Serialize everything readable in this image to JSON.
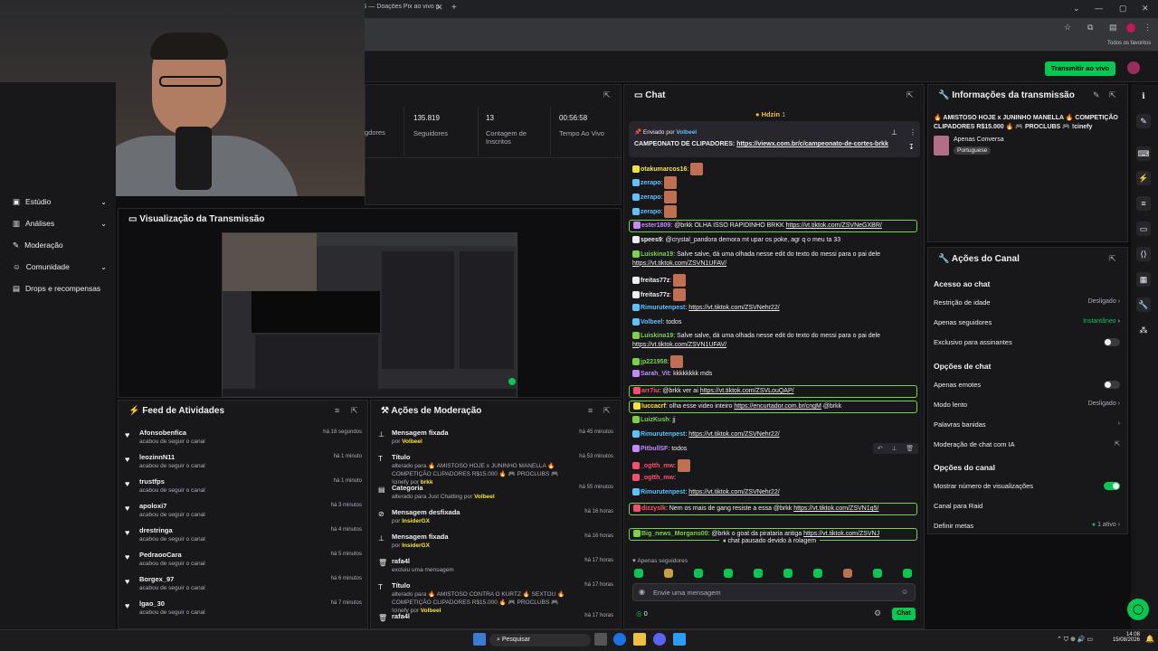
{
  "browser": {
    "tab_title": "G — Doações Pix ao vivo p",
    "bookmarks_label": "Todos os favoritos"
  },
  "header": {
    "go_live_label": "Transmitir ao vivo"
  },
  "sidebar": {
    "items": [
      {
        "label": "Estúdio",
        "icon": "studio-icon"
      },
      {
        "label": "Análises",
        "icon": "chart-icon"
      },
      {
        "label": "Moderação",
        "icon": "wrench-icon"
      },
      {
        "label": "Comunidade",
        "icon": "people-icon"
      },
      {
        "label": "Drops e recompensas",
        "icon": "gift-icon"
      }
    ]
  },
  "stats": [
    {
      "value": "",
      "label": "gdores"
    },
    {
      "value": "135.819",
      "label": "Seguidores"
    },
    {
      "value": "13",
      "label": "Contagem de Inscritos"
    },
    {
      "value": "00:56:58",
      "label": "Tempo Ao Vivo"
    }
  ],
  "preview": {
    "title": "Visualização da Transmissão"
  },
  "feed": {
    "title": "Feed de Atividades",
    "items": [
      {
        "name": "Afonsobenfica",
        "action": "acabou de seguir o canal",
        "time": "há 18 segundos"
      },
      {
        "name": "leozinnN11",
        "action": "acabou de seguir o canal",
        "time": "há 1 minuto"
      },
      {
        "name": "trustfps",
        "action": "acabou de seguir o canal",
        "time": "há 1 minuto"
      },
      {
        "name": "apoloxi7",
        "action": "acabou de seguir o canal",
        "time": "há 3 minutos"
      },
      {
        "name": "drestringa",
        "action": "acabou de seguir o canal",
        "time": "há 4 minutos"
      },
      {
        "name": "PedraooCara",
        "action": "acabou de seguir o canal",
        "time": "há 5 minutos"
      },
      {
        "name": "Borgex_97",
        "action": "acabou de seguir o canal",
        "time": "há 6 minutos"
      },
      {
        "name": "lgao_30",
        "action": "acabou de seguir o canal",
        "time": "há 7 minutos"
      }
    ]
  },
  "moderation": {
    "title": "Ações de Moderação",
    "items": [
      {
        "title": "Mensagem fixada",
        "sub": "por ",
        "by": "Volbeel",
        "time": "há 45 minutos",
        "icon": "pin-icon"
      },
      {
        "title": "Título",
        "sub": "alterado para 🔥 AMISTOSO HOJE x JUNINHO MANELLA 🔥 COMPETIÇÃO CLIPADORES R$15.000 🔥 🎮 PROCLUBS 🎮 !cinefy por ",
        "by": "brkk",
        "time": "há 53 minutos",
        "icon": "text-icon"
      },
      {
        "title": "Categoria",
        "sub": "alterado para Just Chatting por ",
        "by": "Volbeel",
        "time": "há 55 minutos",
        "icon": "category-icon"
      },
      {
        "title": "Mensagem desfixada",
        "sub": "por ",
        "by": "InsiderGX",
        "time": "há 16 horas",
        "icon": "unpin-icon"
      },
      {
        "title": "Mensagem fixada",
        "sub": "por ",
        "by": "InsiderGX",
        "time": "há 16 horas",
        "icon": "pin-icon"
      },
      {
        "title": "rafa4l",
        "sub": "excluiu uma mensagem",
        "by": "",
        "time": "há 17 horas",
        "icon": "trash-icon"
      },
      {
        "title": "Título",
        "sub": "alterado para 🔥 AMISTOSO CONTRA O KURTZ 🔥 SEXTOU 🔥 COMPETIÇÃO CLIPADORES R$15.000 🔥 🎮 PROCLUBS 🎮 !cinefy por ",
        "by": "Volbeel",
        "time": "há 17 horas",
        "icon": "text-icon"
      },
      {
        "title": "rafa4l",
        "sub": "",
        "by": "",
        "time": "há 17 horas",
        "icon": "trash-icon"
      }
    ]
  },
  "chat": {
    "title": "Chat",
    "top_user": "Hdzin",
    "top_count": "1",
    "pinned_label": "Enviado por",
    "pinned_by": "Volbeel",
    "pinned_text": "CAMPEONATO DE CLIPADORES: ",
    "pinned_link": "https://viewx.com.br/c/campeonato-de-cortes-brkk",
    "messages": [
      {
        "user": "otakumarcos16",
        "color": "#f5e52e",
        "text": "",
        "link": "",
        "emote": true,
        "hl": false
      },
      {
        "user": "zerapo",
        "color": "#5cc3ff",
        "text": "",
        "link": "",
        "emote": true,
        "hl": false
      },
      {
        "user": "zerapo",
        "color": "#5cc3ff",
        "text": "",
        "link": "",
        "emote": true,
        "hl": false
      },
      {
        "user": "zerapo",
        "color": "#5cc3ff",
        "text": "",
        "link": "",
        "emote": true,
        "hl": false
      },
      {
        "user": "ester1809",
        "color": "#c08cff",
        "text": "@brkk OLHA ISSO RAPIDINHO BRKK ",
        "link": "https://vt.tiktok.com/ZSVNeGXBR/",
        "emote": false,
        "hl": true
      },
      {
        "user": "spees9",
        "color": "#efeff1",
        "text": "@crystal_pandora demora mt upar os poke, agr q o meu ta 33",
        "link": "",
        "emote": false,
        "hl": false
      },
      {
        "user": "Luiskina19",
        "color": "#7bd148",
        "text": "Salve salve, dá uma olhada nesse edit do texto do messi para o pai dele ",
        "link": "https://vt.tiktok.com/ZSVN1UFAV/",
        "emote": false,
        "hl": false
      },
      {
        "user": "freitas77z",
        "color": "#efeff1",
        "text": "",
        "link": "",
        "emote": true,
        "hl": false
      },
      {
        "user": "freitas77z",
        "color": "#efeff1",
        "text": "",
        "link": "",
        "emote": true,
        "hl": false
      },
      {
        "user": "Rimurutenpest",
        "color": "#5cc3ff",
        "text": "",
        "link": "https://vt.tiktok.com/ZSVNehr22/",
        "emote": false,
        "hl": false
      },
      {
        "user": "Volbeel",
        "color": "#5cc3ff",
        "text": "todos",
        "link": "",
        "emote": false,
        "hl": false
      },
      {
        "user": "Luiskina19",
        "color": "#7bd148",
        "text": "Salve salve, dá uma olhada nesse edit do texto do messi para o pai dele ",
        "link": "https://vt.tiktok.com/ZSVN1UFAV/",
        "emote": false,
        "hl": false
      },
      {
        "user": "jp221958",
        "color": "#7bd148",
        "text": "",
        "link": "",
        "emote": true,
        "hl": false
      },
      {
        "user": "Sarah_Vit",
        "color": "#c08cff",
        "text": "kkkkkkkk mds",
        "link": "",
        "emote": false,
        "hl": false
      },
      {
        "user": "arr7iu",
        "color": "#ff4f6e",
        "text": "@brkk ver ai ",
        "link": "https://vt.tiktok.com/ZSVLouQAP/",
        "emote": false,
        "hl": true
      },
      {
        "user": "luccacrf",
        "color": "#f5e52e",
        "text": "olha esse video inteiro ",
        "link": "https://encurtador.com.br/cngM",
        "extra": " @brkk",
        "emote": false,
        "hl": true
      },
      {
        "user": "LuizKush",
        "color": "#7bd148",
        "text": "jj",
        "link": "",
        "emote": false,
        "hl": false
      },
      {
        "user": "Rimurutenpest",
        "color": "#5cc3ff",
        "text": "",
        "link": "https://vt.tiktok.com/ZSVNehr22/",
        "emote": false,
        "hl": false
      },
      {
        "user": "PitbullSF",
        "color": "#c08cff",
        "text": "todos",
        "link": "",
        "emote": false,
        "hl": false
      },
      {
        "user": "_ogtth_mw",
        "color": "#ff4f6e",
        "text": "",
        "link": "",
        "emote": true,
        "hl": false
      },
      {
        "user": "_ogtth_mw",
        "color": "#ff4f6e",
        "text": "",
        "link": "",
        "emote": false,
        "hl": false
      },
      {
        "user": "Rimurutenpest",
        "color": "#5cc3ff",
        "text": "",
        "link": "https://vt.tiktok.com/ZSVNehr22/",
        "emote": false,
        "hl": false
      },
      {
        "user": "dizzyslk",
        "color": "#ff4f6e",
        "text": "Nem os mais de gang resiste a essa @brkk ",
        "link": "https://vt.tiktok.com/ZSVN1q5/",
        "emote": false,
        "hl": true
      },
      {
        "user": "Big_news_Morgans00",
        "color": "#7bd148",
        "text": "@brkk o goat da pirataria antiga ",
        "link": "https://vt.tiktok.com/ZSVNJ",
        "emote": false,
        "hl": true
      }
    ],
    "paused": "chat pausado devido à rolagem",
    "followers_only": "Apenas seguidores",
    "input_placeholder": "Envie uma mensagem",
    "points": "0",
    "send_label": "Chat"
  },
  "info": {
    "title": "Informações da transmissão",
    "stream_title": "🔥 AMISTOSO HOJE x JUNINHO MANELLA 🔥 COMPETIÇÃO CLIPADORES R$15.000 🔥 🎮 PROCLUBS 🎮 !cinefy",
    "category": "Apenas Conversa",
    "language": "Portuguese"
  },
  "channel_actions": {
    "title": "Ações do Canal",
    "chat_access": "Acesso ao chat",
    "age": {
      "label": "Restrição de idade",
      "value": "Desligado"
    },
    "followers": {
      "label": "Apenas seguidores",
      "value": "Instantâneo"
    },
    "subs": {
      "label": "Exclusivo para assinantes"
    },
    "chat_options": "Opções de chat",
    "emotes": {
      "label": "Apenas emotes"
    },
    "slow": {
      "label": "Modo lento",
      "value": "Desligado"
    },
    "banned": {
      "label": "Palavras banidas"
    },
    "ai": {
      "label": "Moderação de chat com IA"
    },
    "channel_options": "Opções do canal",
    "viewcount": {
      "label": "Mostrar número de visualizações"
    },
    "raid": {
      "label": "Canal para Raid"
    },
    "goals": {
      "label": "Definir metas",
      "value": "1 ativo"
    }
  },
  "taskbar": {
    "search": "Pesquisar",
    "time": "14:08",
    "date": "15/08/2026"
  },
  "colors": {
    "accent": "#00c853",
    "panel": "#18181b",
    "bg": "#0e0e10"
  }
}
